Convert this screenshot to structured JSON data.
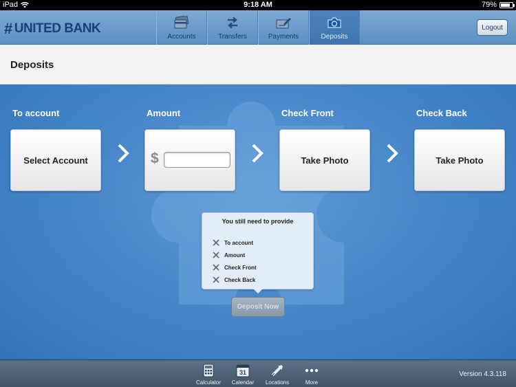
{
  "statusbar": {
    "carrier": "iPad",
    "time": "9:18 AM",
    "battery": "79%",
    "battery_level": 0.79
  },
  "header": {
    "logo": "UNITED BANK",
    "tabs": [
      {
        "label": "Accounts",
        "icon": "cards-icon",
        "active": false
      },
      {
        "label": "Transfers",
        "icon": "transfer-arrows-icon",
        "active": false
      },
      {
        "label": "Payments",
        "icon": "pen-paper-icon",
        "active": false
      },
      {
        "label": "Deposits",
        "icon": "camera-icon",
        "active": true
      }
    ],
    "logout": "Logout"
  },
  "page": {
    "title": "Deposits"
  },
  "steps": {
    "account": {
      "label": "To account",
      "button": "Select Account"
    },
    "amount": {
      "label": "Amount",
      "currency": "$",
      "value": "",
      "placeholder": ""
    },
    "front": {
      "label": "Check Front",
      "button": "Take Photo"
    },
    "back": {
      "label": "Check Back",
      "button": "Take Photo"
    }
  },
  "requirements": {
    "title": "You still need to provide",
    "items": [
      "To account",
      "Amount",
      "Check Front",
      "Check Back"
    ]
  },
  "deposit_button": "Deposit Now",
  "footer": {
    "tools": [
      {
        "label": "Calculator",
        "icon": "calculator-icon"
      },
      {
        "label": "Calendar",
        "icon": "calendar-icon",
        "day": "31"
      },
      {
        "label": "Locations",
        "icon": "map-pin-icon"
      },
      {
        "label": "More",
        "icon": "more-dots-icon"
      }
    ],
    "version": "Version 4.3.118"
  },
  "colors": {
    "accent": "#3d7fc4",
    "header": "#6f9dcc",
    "logo": "#173f7a"
  }
}
